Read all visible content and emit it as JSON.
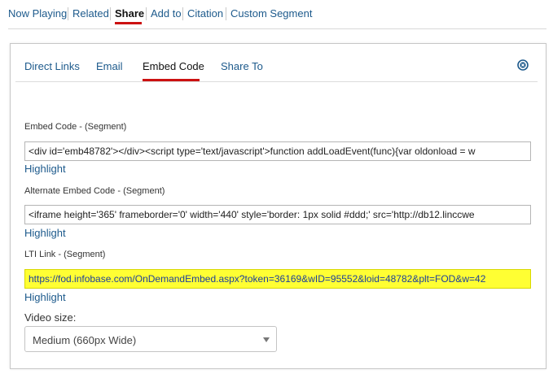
{
  "topnav": {
    "items": [
      {
        "label": "Now Playing"
      },
      {
        "label": "Related"
      },
      {
        "label": "Share"
      },
      {
        "label": "Add to"
      },
      {
        "label": "Citation"
      },
      {
        "label": "Custom Segment"
      }
    ],
    "active": "Share"
  },
  "tabs": {
    "items": [
      {
        "label": "Direct Links"
      },
      {
        "label": "Email"
      },
      {
        "label": "Embed Code"
      },
      {
        "label": "Share To"
      }
    ],
    "active": "Embed Code"
  },
  "embed": {
    "label": "Embed Code - (Segment)",
    "value": "<div id='emb48782'></div><script type='text/javascript'>function addLoadEvent(func){var oldonload = w",
    "highlight": "Highlight"
  },
  "alt_embed": {
    "label": "Alternate Embed Code - (Segment)",
    "value": "<iframe height='365' frameborder='0' width='440' style='border: 1px solid #ddd;'  src='http://db12.linccwe",
    "highlight": "Highlight"
  },
  "lti": {
    "label": "LTI Link - (Segment)",
    "value": "https://fod.infobase.com/OnDemandEmbed.aspx?token=36169&wID=95552&loid=48782&plt=FOD&w=42",
    "highlight": "Highlight"
  },
  "video_size": {
    "label": "Video size:",
    "selected": "Medium (660px Wide)"
  },
  "colors": {
    "link": "#1d5a8c",
    "active_underline": "#cc1111",
    "highlight_bg": "#ffff33"
  },
  "icons": {
    "close": "close-circle-icon",
    "dropdown": "chevron-down-icon"
  }
}
